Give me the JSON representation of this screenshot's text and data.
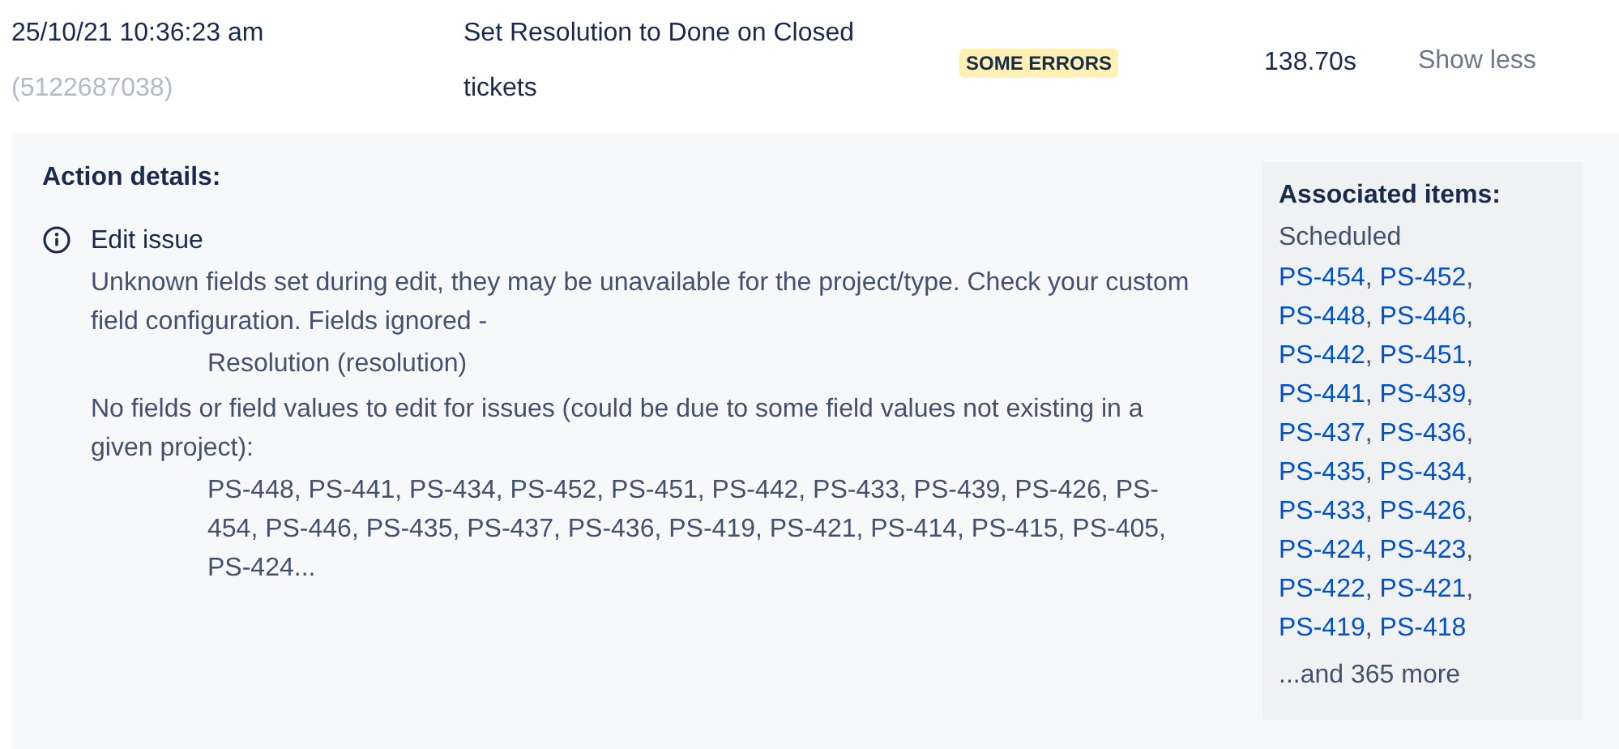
{
  "run": {
    "timestamp": "25/10/21 10:36:23 am",
    "run_id": "(5122687038)",
    "rule_name": "Set Resolution to Done on Closed tickets",
    "status": {
      "label": "SOME ERRORS",
      "kind": "warning"
    },
    "duration": "138.70s",
    "toggle": "Show less"
  },
  "action_details": {
    "heading": "Action details:",
    "actions": [
      {
        "title": "Edit issue",
        "messages": [
          {
            "text": "Unknown fields set during edit, they may be unavailable for the project/type. Check your custom field configuration. Fields ignored -",
            "detail": "Resolution (resolution)"
          },
          {
            "text": "No fields or field values to edit for issues (could be due to some field values not existing in a given project):",
            "detail": "PS-448, PS-441, PS-434, PS-452, PS-451, PS-442, PS-433, PS-439, PS-426, PS-454, PS-446, PS-435, PS-437, PS-436, PS-419, PS-421, PS-414, PS-415, PS-405, PS-424..."
          }
        ]
      }
    ]
  },
  "associated_items": {
    "heading": "Associated items:",
    "group": "Scheduled",
    "separator": ",",
    "issues": [
      "PS-454",
      "PS-452",
      "PS-448",
      "PS-446",
      "PS-442",
      "PS-451",
      "PS-441",
      "PS-439",
      "PS-437",
      "PS-436",
      "PS-435",
      "PS-434",
      "PS-433",
      "PS-426",
      "PS-424",
      "PS-423",
      "PS-422",
      "PS-421",
      "PS-419",
      "PS-418"
    ],
    "more": "...and 365 more"
  }
}
